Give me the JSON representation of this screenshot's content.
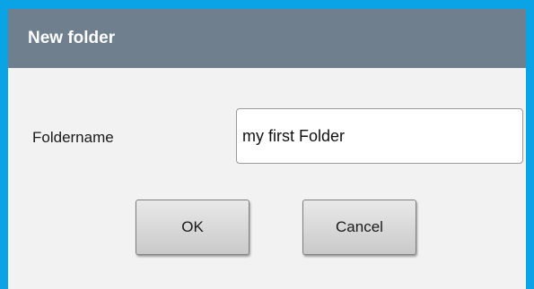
{
  "dialog": {
    "title": "New folder",
    "field_label": "Foldername",
    "field_value": "my first Folder",
    "ok_label": "OK",
    "cancel_label": "Cancel",
    "accent_color": "#0aa3e6",
    "titlebar_color": "#6f7f8e"
  }
}
